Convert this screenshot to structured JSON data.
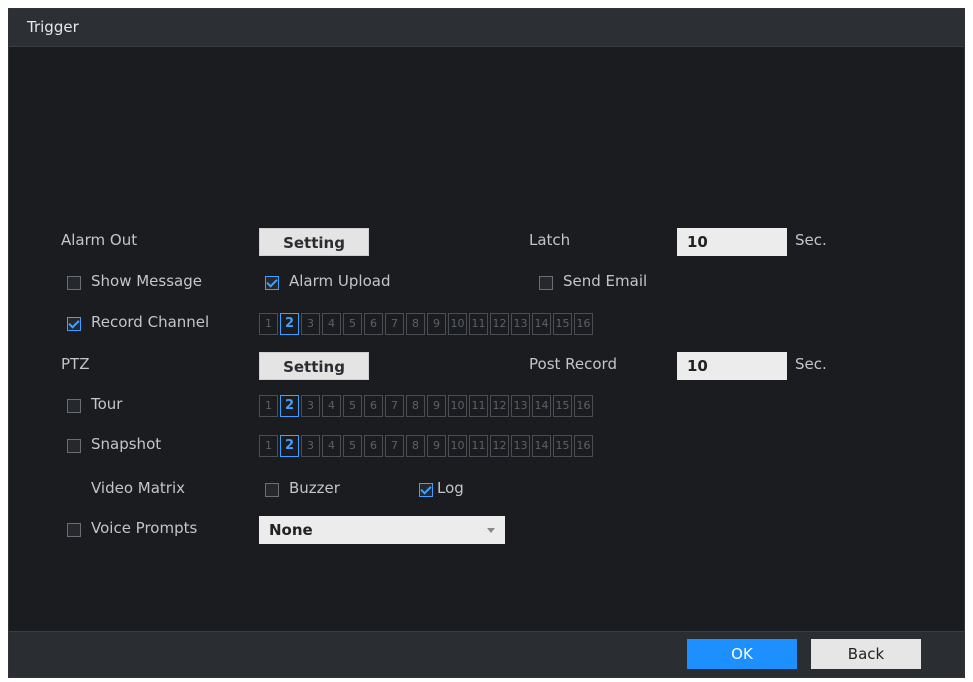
{
  "dialog": {
    "title": "Trigger"
  },
  "alarm_out": {
    "label": "Alarm Out",
    "button": "Setting"
  },
  "latch": {
    "label": "Latch",
    "value": "10",
    "unit": "Sec."
  },
  "show_message": {
    "label": "Show Message",
    "checked": false
  },
  "alarm_upload": {
    "label": "Alarm Upload",
    "checked": true
  },
  "send_email": {
    "label": "Send Email",
    "checked": false
  },
  "record_channel": {
    "label": "Record Channel",
    "checked": true
  },
  "ptz": {
    "label": "PTZ",
    "button": "Setting"
  },
  "post_record": {
    "label": "Post Record",
    "value": "10",
    "unit": "Sec."
  },
  "tour": {
    "label": "Tour",
    "checked": false
  },
  "snapshot": {
    "label": "Snapshot",
    "checked": false
  },
  "video_matrix": {
    "label": "Video Matrix"
  },
  "buzzer": {
    "label": "Buzzer",
    "checked": false
  },
  "log": {
    "label": "Log",
    "checked": true
  },
  "voice_prompts": {
    "label": "Voice Prompts",
    "checked": false,
    "selected": "None"
  },
  "channels": [
    "1",
    "2",
    "3",
    "4",
    "5",
    "6",
    "7",
    "8",
    "9",
    "10",
    "11",
    "12",
    "13",
    "14",
    "15",
    "16"
  ],
  "selected_channel": "2",
  "footer": {
    "ok": "OK",
    "back": "Back"
  },
  "colors": {
    "accent": "#3ea0ff",
    "ok_button": "#1e8fff",
    "background": "#1a1c1f"
  }
}
